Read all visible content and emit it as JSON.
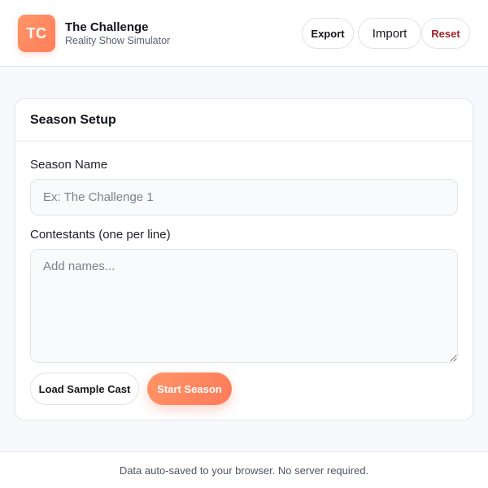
{
  "header": {
    "logo_text": "TC",
    "title": "The Challenge",
    "subtitle": "Reality Show Simulator",
    "buttons": {
      "export": "Export",
      "import": "Import",
      "reset": "Reset"
    }
  },
  "setup": {
    "title": "Season Setup",
    "season_name": {
      "label": "Season Name",
      "value": "",
      "placeholder": "Ex: The Challenge 1"
    },
    "contestants": {
      "label": "Contestants (one per line)",
      "value": "",
      "placeholder": "Add names..."
    },
    "load_sample_label": "Load Sample Cast",
    "start_label": "Start Season"
  },
  "footer": {
    "text": "Data auto-saved to your browser. No server required."
  },
  "colors": {
    "accent": "#ff8a5f",
    "danger": "#a1202a",
    "background": "#f8f9fc"
  }
}
